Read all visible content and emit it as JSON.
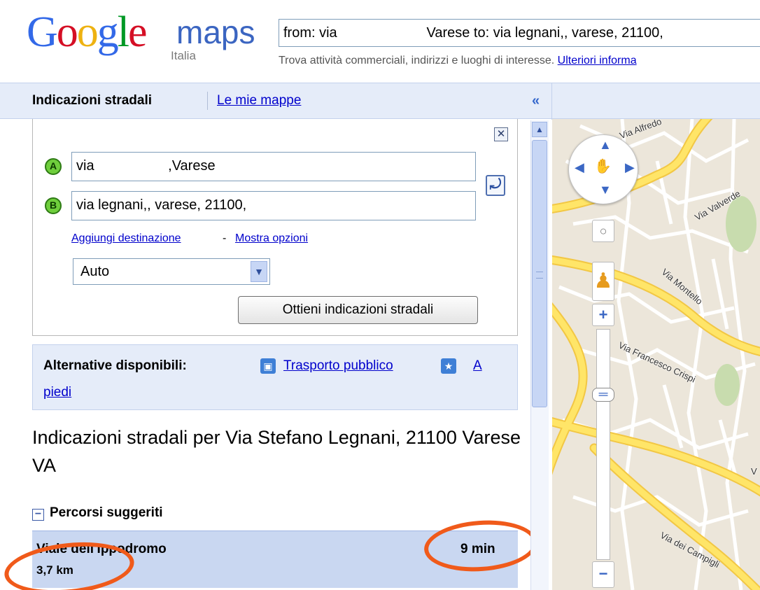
{
  "header": {
    "logo_google": [
      "G",
      "o",
      "o",
      "g",
      "l",
      "e"
    ],
    "logo_google_colors": [
      "#3369e8",
      "#d50f25",
      "#eeb211",
      "#3369e8",
      "#009925",
      "#d50f25"
    ],
    "logo_maps": "maps",
    "logo_country": "Italia",
    "search_value": "from: via                       Varese to: via legnani,, varese, 21100,",
    "tagline": "Trova attività commerciali, indirizzi e luoghi di interesse.",
    "tagline_link": "Ulteriori informa"
  },
  "tabs": {
    "directions": "Indicazioni stradali",
    "my_maps": "Le mie mappe",
    "collapse": "«"
  },
  "form": {
    "close": "✕",
    "marker_a": "A",
    "marker_b": "B",
    "field_a": "via                   ,Varese",
    "field_b": "via legnani,, varese, 21100,",
    "swap": "⤾",
    "add_destination": "Aggiungi destinazione",
    "separator": "-",
    "show_options": "Mostra opzioni",
    "mode": "Auto",
    "get_directions": "Ottieni indicazioni stradali"
  },
  "alternatives": {
    "label": "Alternative disponibili:",
    "transit": "Trasporto pubblico",
    "walk_part1": "A",
    "walk_part2": "piedi"
  },
  "result": {
    "title": "Indicazioni stradali per Via Stefano Legnani, 21100 Varese VA",
    "routes_heading": "Percorsi suggeriti",
    "toggle": "−",
    "route_name": "Viale dell'Ippodromo",
    "route_time": "9 min",
    "route_distance": "3,7 km"
  },
  "map": {
    "labels": [
      "Via Alfredo",
      "Via Valverde",
      "Via Montello",
      "Via Francesco Crispi",
      "Via dei Campigli",
      "V"
    ],
    "reset": "○",
    "zoom_in": "+",
    "zoom_out": "−",
    "zoom_thumb": "═"
  },
  "colors": {
    "annotation": "#f05a1a",
    "tab_bar": "#e5ecf9",
    "route_row": "#c9d7f1",
    "road": "#ffe568",
    "link": "#0000cc"
  }
}
